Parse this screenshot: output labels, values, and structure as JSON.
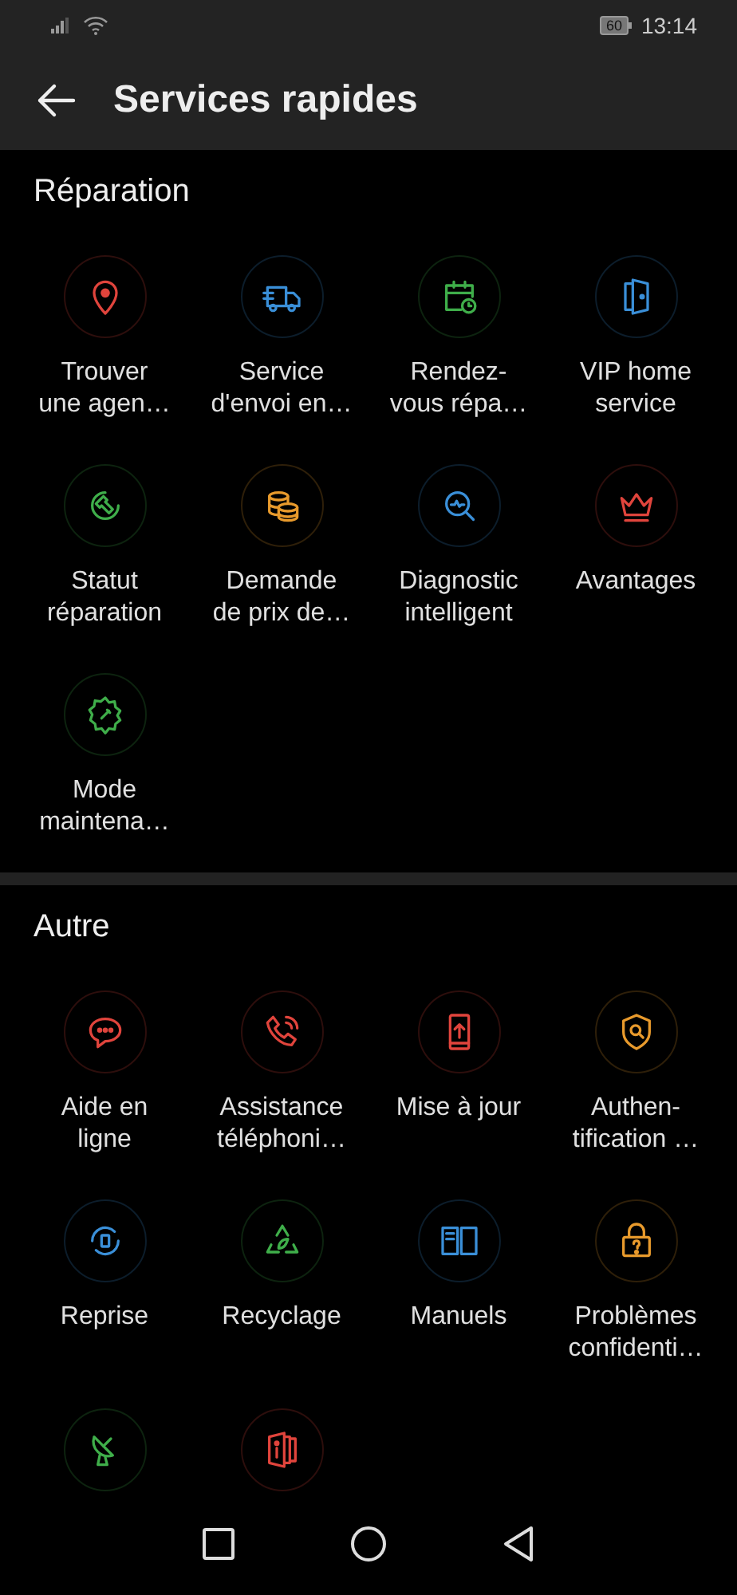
{
  "status_bar": {
    "battery": "60",
    "time": "13:14"
  },
  "header": {
    "title": "Services rapides"
  },
  "sections": [
    {
      "title": "Réparation",
      "items": [
        {
          "kind": "labeled",
          "label": "Trouver\nune agen…"
        },
        {
          "kind": "labeled",
          "label": "Service\nd'envoi en…"
        },
        {
          "kind": "labeled",
          "label": "Rendez-\nvous répa…"
        },
        {
          "kind": "labeled",
          "label": "VIP home\nservice"
        },
        {
          "kind": "labeled",
          "label": "Statut\nréparation"
        },
        {
          "kind": "labeled",
          "label": "Demande\nde prix de…"
        },
        {
          "kind": "labeled",
          "label": "Diagnostic\nintelligent"
        },
        {
          "kind": "labeled",
          "label": "Avantages"
        },
        {
          "kind": "labeled",
          "label": "Mode\nmaintena…"
        }
      ]
    },
    {
      "title": "Autre",
      "items": [
        {
          "kind": "labeled",
          "label": "Aide en\nligne"
        },
        {
          "kind": "labeled",
          "label": "Assistance\ntéléphoni…"
        },
        {
          "kind": "labeled",
          "label": "Mise à jour"
        },
        {
          "kind": "labeled",
          "label": "Authen-\ntification …"
        },
        {
          "kind": "labeled",
          "label": "Reprise"
        },
        {
          "kind": "labeled",
          "label": "Recyclage"
        },
        {
          "kind": "labeled",
          "label": "Manuels"
        },
        {
          "kind": "labeled",
          "label": "Problèmes\nconfidenti…"
        },
        {
          "kind": "icon_only"
        },
        {
          "kind": "icon_only"
        }
      ]
    }
  ]
}
